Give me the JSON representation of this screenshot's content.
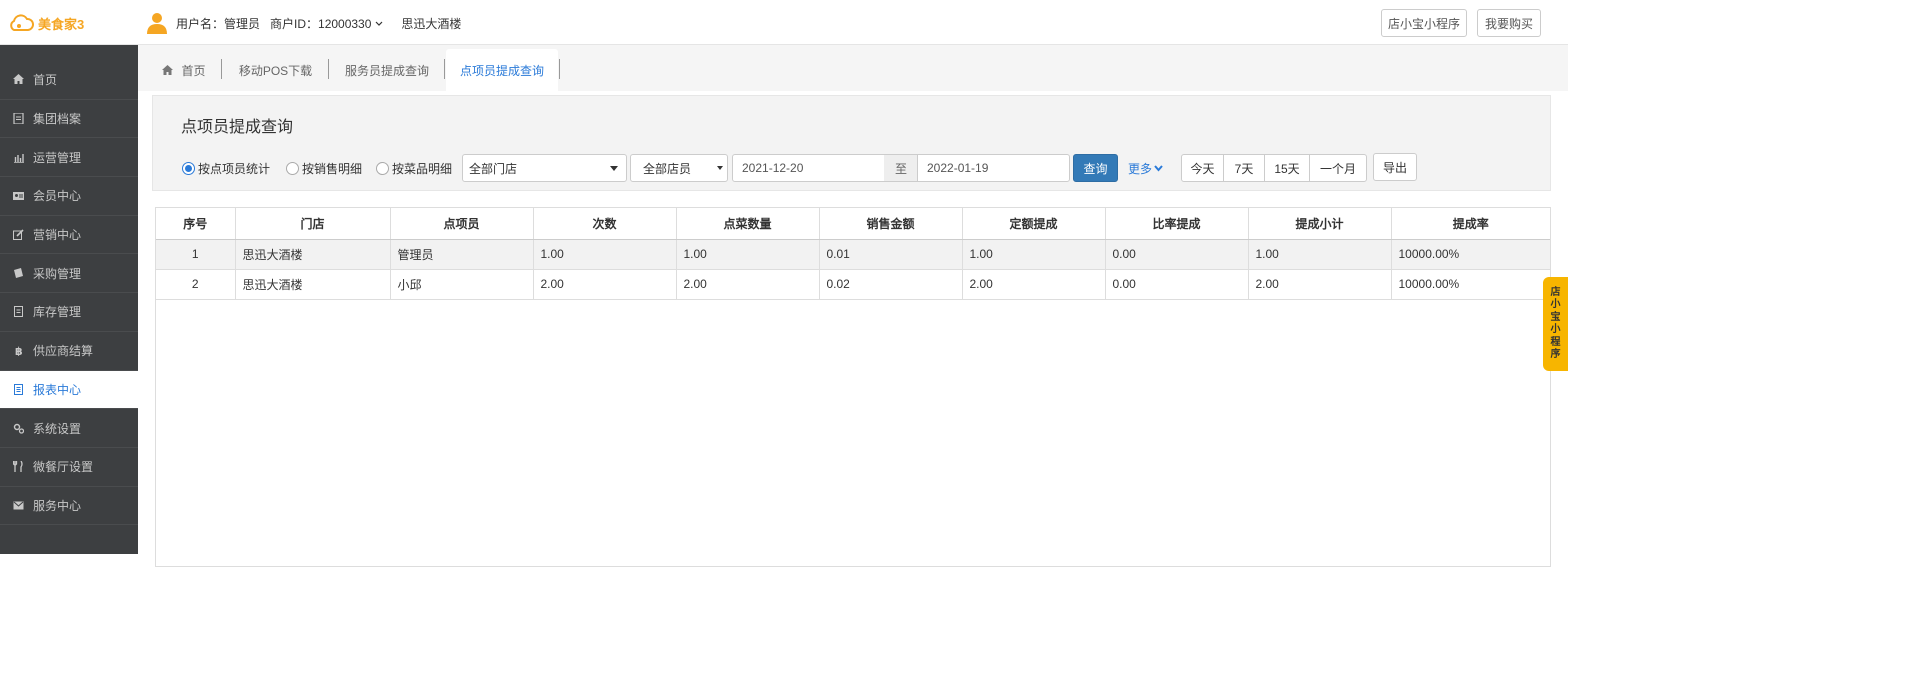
{
  "app": {
    "logo_text": "美食家3",
    "user_label": "用户名：管理员",
    "merchant_label": "商户ID：12000330",
    "store_name": "思迅大酒楼",
    "btn_miniprogram": "店小宝小程序",
    "btn_buy": "我要购买"
  },
  "sidebar": {
    "items": [
      {
        "label": "首页",
        "icon": "home-icon"
      },
      {
        "label": "集团档案",
        "icon": "file-icon"
      },
      {
        "label": "运营管理",
        "icon": "bar-chart-icon"
      },
      {
        "label": "会员中心",
        "icon": "id-card-icon"
      },
      {
        "label": "营销中心",
        "icon": "edit-icon"
      },
      {
        "label": "采购管理",
        "icon": "book-icon"
      },
      {
        "label": "库存管理",
        "icon": "document-icon"
      },
      {
        "label": "供应商结算",
        "icon": "bitcoin-icon"
      },
      {
        "label": "报表中心",
        "icon": "report-icon",
        "active": true
      },
      {
        "label": "系统设置",
        "icon": "gears-icon"
      },
      {
        "label": "微餐厅设置",
        "icon": "cutlery-icon"
      },
      {
        "label": "服务中心",
        "icon": "envelope-icon"
      }
    ]
  },
  "tabs": [
    {
      "label": "首页"
    },
    {
      "label": "移动POS下载"
    },
    {
      "label": "服务员提成查询"
    },
    {
      "label": "点项员提成查询",
      "active": true
    }
  ],
  "panel": {
    "title": "点项员提成查询",
    "radios": [
      {
        "label": "按点项员统计",
        "checked": true
      },
      {
        "label": "按销售明细",
        "checked": false
      },
      {
        "label": "按菜品明细",
        "checked": false
      }
    ],
    "store_select": "全部门店",
    "staff_select": "全部店员",
    "date_from": "2021-12-20",
    "date_sep": "至",
    "date_to": "2022-01-19",
    "query_btn": "查询",
    "more_label": "更多",
    "range_btns": [
      "今天",
      "7天",
      "15天",
      "一个月"
    ],
    "export_btn": "导出"
  },
  "table": {
    "columns": [
      "序号",
      "门店",
      "点项员",
      "次数",
      "点菜数量",
      "销售金额",
      "定额提成",
      "比率提成",
      "提成小计",
      "提成率"
    ],
    "rows": [
      [
        "1",
        "思迅大酒楼",
        "管理员",
        "1.00",
        "1.00",
        "0.01",
        "1.00",
        "0.00",
        "1.00",
        "10000.00%"
      ],
      [
        "2",
        "思迅大酒楼",
        "小邱",
        "2.00",
        "2.00",
        "0.02",
        "2.00",
        "0.00",
        "2.00",
        "10000.00%"
      ]
    ]
  },
  "float_tab": [
    "店",
    "小",
    "宝",
    "小",
    "程",
    "序"
  ],
  "colors": {
    "accent": "#2a7ad8",
    "sidebar_bg": "#3d3f41",
    "logo": "#f5a623",
    "float_tab": "#f7b500"
  }
}
